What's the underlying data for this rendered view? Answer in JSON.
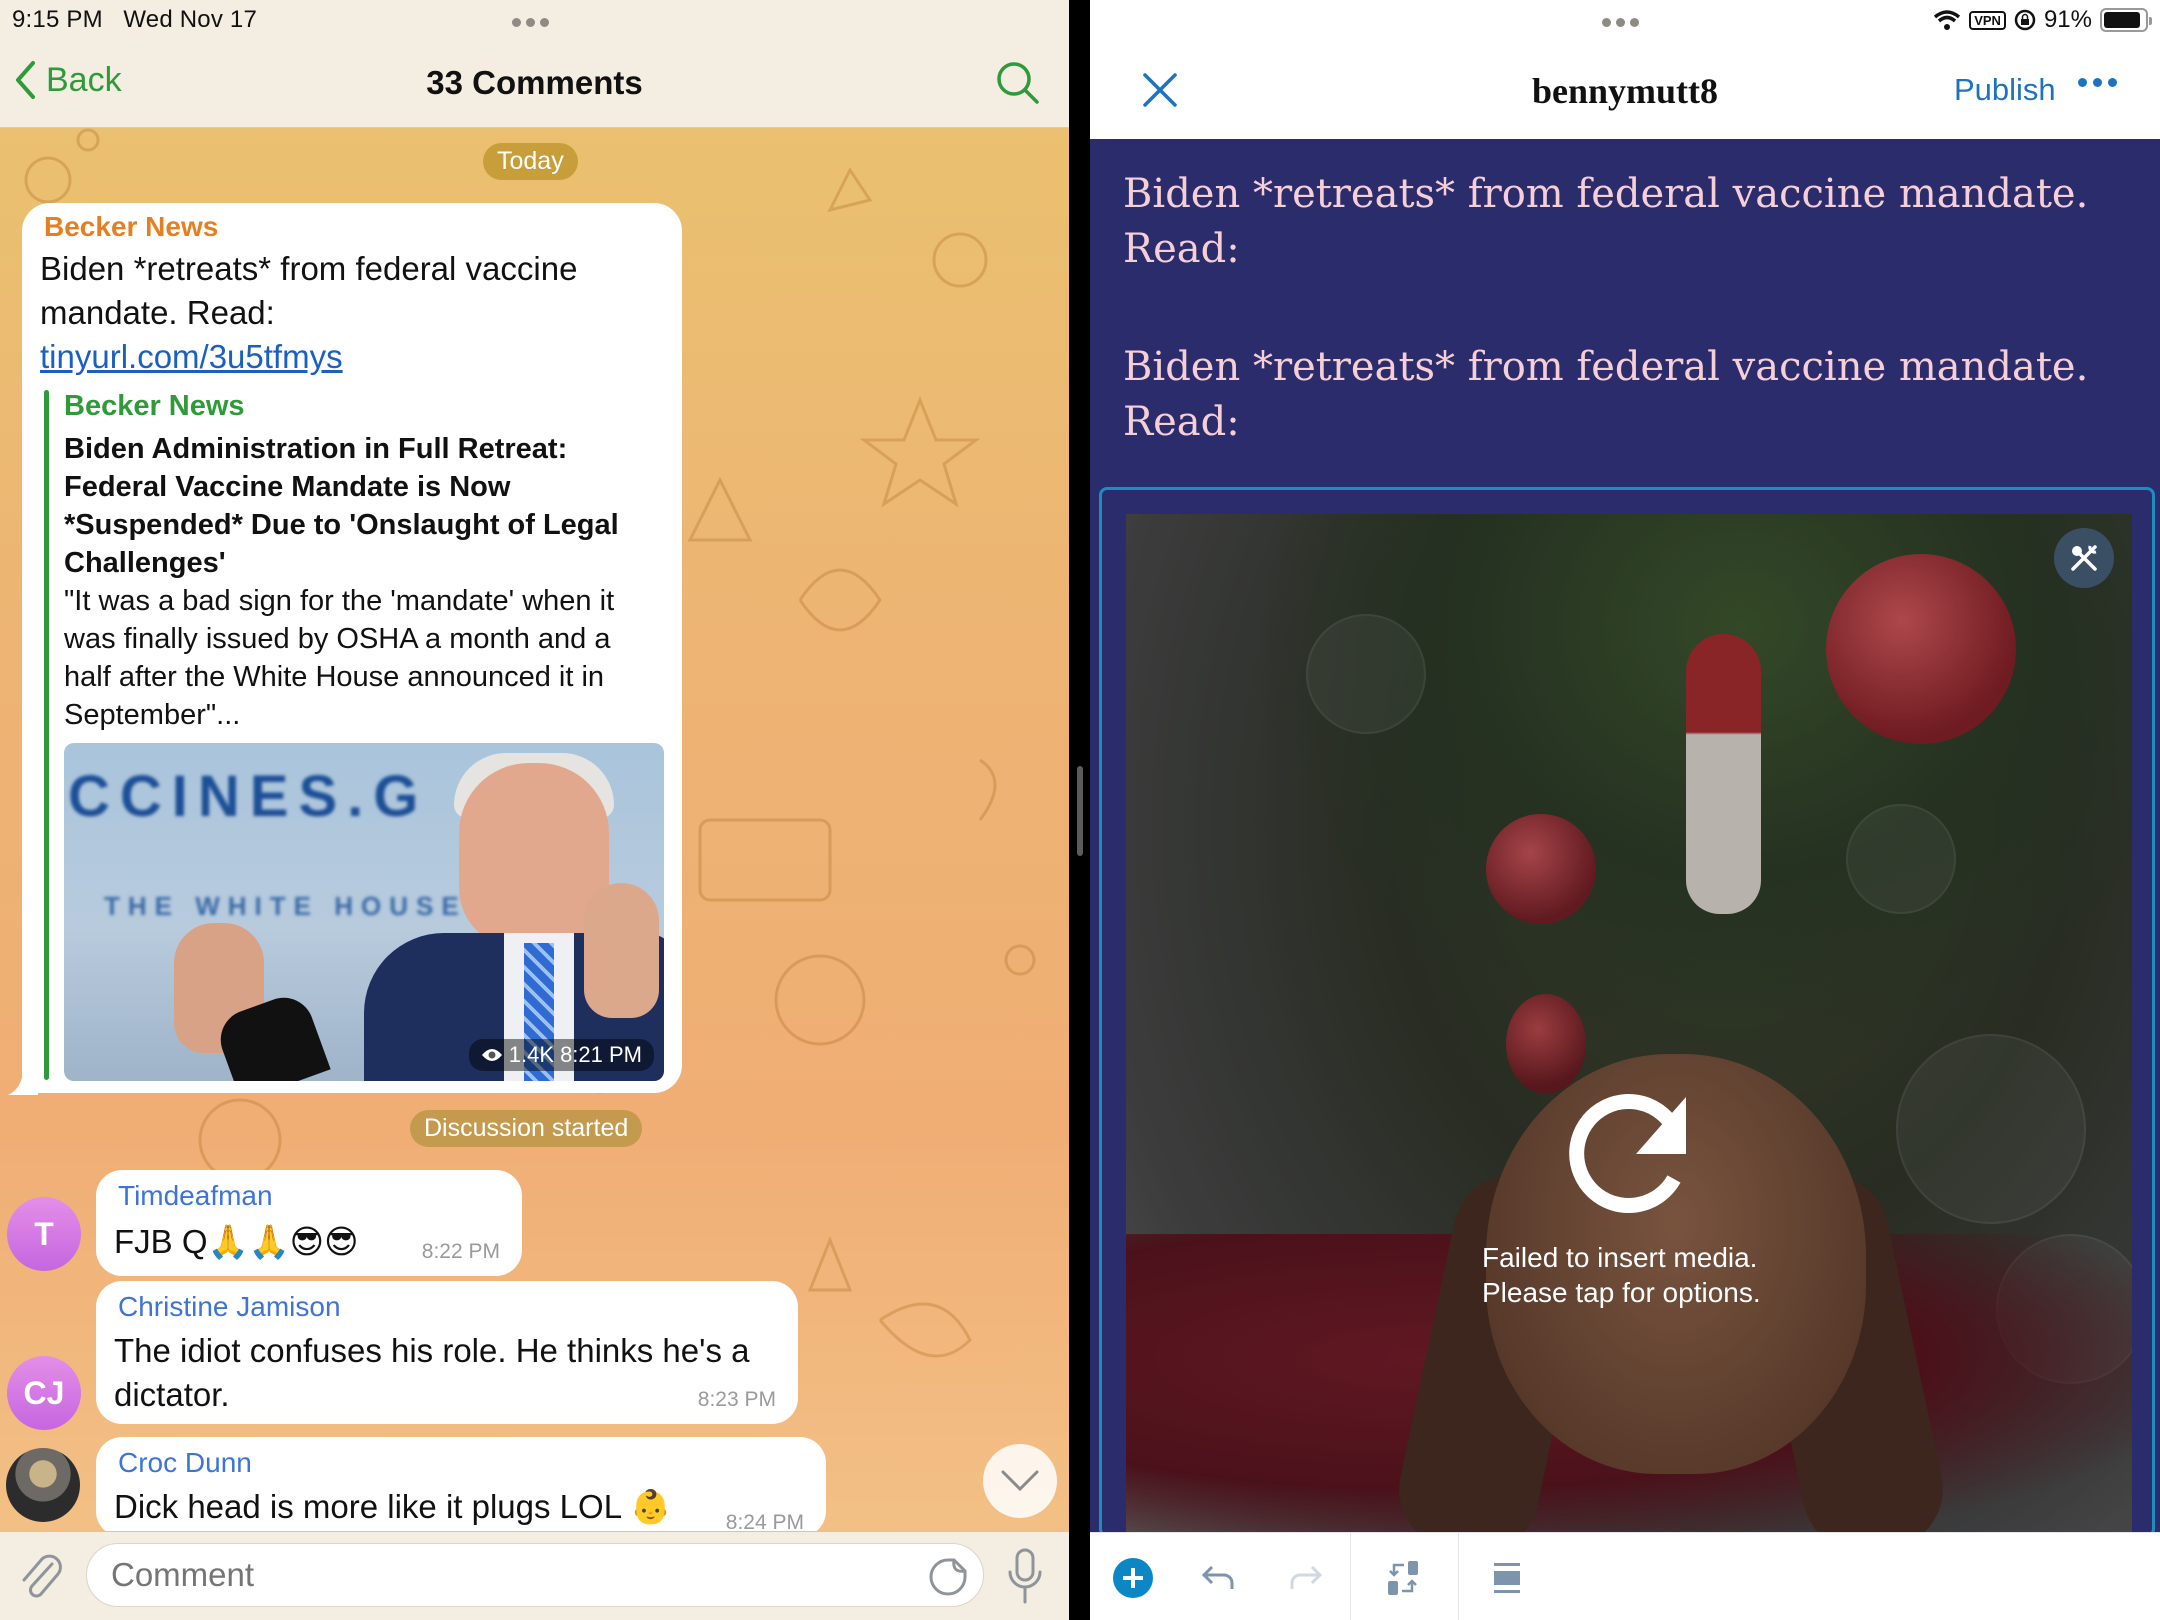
{
  "left_pane": {
    "status_bar": {
      "time": "9:15 PM",
      "date": "Wed Nov 17"
    },
    "nav": {
      "back_label": "Back",
      "title": "33 Comments",
      "back_icon": "chevron-left-icon",
      "search_icon": "search-icon"
    },
    "date_pill": "Today",
    "post": {
      "author": "Becker News",
      "text": "Biden *retreats* from federal vaccine mandate. Read:",
      "link": "tinyurl.com/3u5tfmys",
      "preview": {
        "source": "Becker News",
        "title": "Biden Administration in Full Retreat: Federal Vaccine Mandate is Now *Suspended* Due to 'Onslaught of Legal Challenges'",
        "description": "\"It was a bad sign for the 'mandate' when it was finally issued by OSHA a month and a half after the White House announced it in September\"...",
        "image_banner_text": "CCINES.G",
        "image_sub_text": "THE WHITE HOUSE",
        "views": "1.4K",
        "time": "8:21 PM"
      }
    },
    "service_pill": "Discussion started",
    "comments": [
      {
        "author": "Timdeafman",
        "avatar_initials": "T",
        "text": "FJB Q🙏🙏😎😎",
        "time": "8:22 PM"
      },
      {
        "author": "Christine Jamison",
        "avatar_initials": "CJ",
        "text": "The idiot confuses his role. He thinks he's a dictator.",
        "time": "8:23 PM"
      },
      {
        "author": "Croc Dunn",
        "avatar_initials": "",
        "text": "Dick head is more like it plugs LOL 👶",
        "time": "8:24 PM"
      }
    ],
    "input": {
      "placeholder": "Comment",
      "value": ""
    }
  },
  "right_pane": {
    "status_bar": {
      "vpn_label": "VPN",
      "battery": "91%",
      "battery_level": 0.91
    },
    "nav": {
      "title": "bennymutt8",
      "publish_label": "Publish",
      "close_icon": "close-icon",
      "more_icon": "more-horizontal-icon"
    },
    "paragraphs": [
      "Biden *retreats* from federal vaccine mandate. Read:",
      "Biden *retreats* from federal vaccine mandate. Read:"
    ],
    "image_block": {
      "error_line1": "Failed to insert media.",
      "error_line2": "Please tap for options.",
      "retry_icon": "retry-icon",
      "tools_icon": "tools-icon"
    },
    "toolbar": [
      "add-block-icon",
      "undo-icon",
      "redo-icon",
      "block-mover-icon",
      "block-settings-icon"
    ]
  },
  "colors": {
    "telegram_green": "#2f9a3a",
    "link_blue": "#1b5fbf",
    "author_orange": "#e67e22",
    "commenter_blue": "#3d74d6",
    "wp_blue": "#1e73be",
    "editor_bg": "#2b2c6b",
    "editor_text": "#f6cfd6"
  }
}
